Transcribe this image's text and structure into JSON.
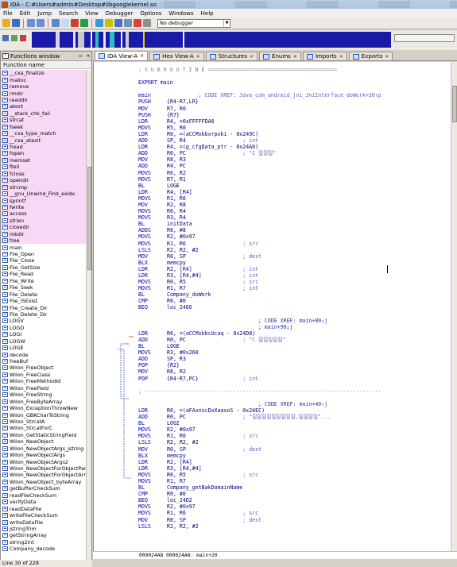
{
  "window": {
    "title": "IDA - C:#Users#admin#Desktop#libgooglekernel.so"
  },
  "menu": [
    "File",
    "Edit",
    "Jump",
    "Search",
    "View",
    "Debugger",
    "Options",
    "Windows",
    "Help"
  ],
  "toolbar": {
    "debugger_select": "No debugger"
  },
  "functions_window": {
    "title": "Functions window",
    "column_header": "Function name",
    "status": "Line 30 of 228",
    "items": [
      {
        "name": "__cxa_finalize",
        "lib": true
      },
      {
        "name": "malloc",
        "lib": true
      },
      {
        "name": "remove",
        "lib": true
      },
      {
        "name": "rmdir",
        "lib": true
      },
      {
        "name": "readdir",
        "lib": true
      },
      {
        "name": "abort",
        "lib": true
      },
      {
        "name": "__stack_chk_fail",
        "lib": true
      },
      {
        "name": "strcat",
        "lib": true
      },
      {
        "name": "fseek",
        "lib": true
      },
      {
        "name": "__cxa_type_match",
        "lib": true
      },
      {
        "name": "__cxa_atexit",
        "lib": true
      },
      {
        "name": "fread",
        "lib": true
      },
      {
        "name": "fopen",
        "lib": true
      },
      {
        "name": "memset",
        "lib": true
      },
      {
        "name": "ftell",
        "lib": true
      },
      {
        "name": "fclose",
        "lib": true
      },
      {
        "name": "opendir",
        "lib": true
      },
      {
        "name": "strcmp",
        "lib": true
      },
      {
        "name": "__gnu_Unwind_Find_exidx",
        "lib": true
      },
      {
        "name": "sprintf",
        "lib": true
      },
      {
        "name": "fwrite",
        "lib": true
      },
      {
        "name": "access",
        "lib": true
      },
      {
        "name": "strlen",
        "lib": true
      },
      {
        "name": "closedir",
        "lib": true
      },
      {
        "name": "mkdir",
        "lib": true
      },
      {
        "name": "free",
        "lib": true
      },
      {
        "name": "main",
        "lib": false
      },
      {
        "name": "File_Open",
        "lib": false
      },
      {
        "name": "File_Close",
        "lib": false
      },
      {
        "name": "File_GetSize",
        "lib": false
      },
      {
        "name": "File_Read",
        "lib": false
      },
      {
        "name": "File_Write",
        "lib": false
      },
      {
        "name": "File_Seek",
        "lib": false
      },
      {
        "name": "File_Delete",
        "lib": false
      },
      {
        "name": "File_ISExist",
        "lib": false
      },
      {
        "name": "File_Create_Dir",
        "lib": false
      },
      {
        "name": "File_Delete_Dir",
        "lib": false
      },
      {
        "name": "LOGV",
        "lib": false
      },
      {
        "name": "LOGD",
        "lib": false
      },
      {
        "name": "LOGI",
        "lib": false
      },
      {
        "name": "LOGW",
        "lib": false
      },
      {
        "name": "LOGE",
        "lib": false
      },
      {
        "name": "decode",
        "lib": false
      },
      {
        "name": "freeBuf",
        "lib": false
      },
      {
        "name": "Wilon_FreeObject",
        "lib": false
      },
      {
        "name": "Wilon_FreeClass",
        "lib": false
      },
      {
        "name": "Wilon_FreeMethodId",
        "lib": false
      },
      {
        "name": "Wilon_FreeField",
        "lib": false
      },
      {
        "name": "Wilon_FreeString",
        "lib": false
      },
      {
        "name": "Wilon_FreeByteArray",
        "lib": false
      },
      {
        "name": "Wilon_ExceptionThrowNew",
        "lib": false
      },
      {
        "name": "Wilon_GBKCharToString",
        "lib": false
      },
      {
        "name": "Wilon_StrcatA",
        "lib": false
      },
      {
        "name": "Wilon_StrcatForC",
        "lib": false
      },
      {
        "name": "Wilon_GetStaticStringField",
        "lib": false
      },
      {
        "name": "Wilon_NewObject",
        "lib": false
      },
      {
        "name": "Wilon_NewObjectArgs_jstring",
        "lib": false
      },
      {
        "name": "Wilon_NewObjectArgs",
        "lib": false
      },
      {
        "name": "Wilon_NewObjectArgs2",
        "lib": false
      },
      {
        "name": "Wilon_NewObjectForObjectParam",
        "lib": false
      },
      {
        "name": "Wilon_NewObjectForObjectArray",
        "lib": false
      },
      {
        "name": "Wilon_NewObject_byteArray",
        "lib": false
      },
      {
        "name": "getBufferCheckSum",
        "lib": false
      },
      {
        "name": "readFileCheckSum",
        "lib": false
      },
      {
        "name": "verifyData",
        "lib": false
      },
      {
        "name": "readDataFile",
        "lib": false
      },
      {
        "name": "writeFileCheckSum",
        "lib": false
      },
      {
        "name": "writeDataFile",
        "lib": false
      },
      {
        "name": "jstringTrim",
        "lib": false
      },
      {
        "name": "getStringArray",
        "lib": false
      },
      {
        "name": "string2int",
        "lib": false
      },
      {
        "name": "Company_decode",
        "lib": false
      }
    ]
  },
  "tabs": [
    {
      "label": "IDA View-A",
      "active": true,
      "closable": true
    },
    {
      "label": "Hex View-A",
      "active": false,
      "closable": true
    },
    {
      "label": "Structures",
      "active": false,
      "closable": true
    },
    {
      "label": "Enums",
      "active": false,
      "closable": true
    },
    {
      "label": "Imports",
      "active": false,
      "closable": true
    },
    {
      "label": "Exports",
      "active": false,
      "closable": true
    }
  ],
  "code": {
    "header": "; S U B R O U T I N E =========================================",
    "lines": [
      {
        "t": "blank"
      },
      {
        "t": "label",
        "text": "EXPORT main"
      },
      {
        "t": "blank"
      },
      {
        "t": "label",
        "text": "main",
        "cm": "; CODE XREF: Java_com_android_jni_JniInterface_doWork+30↑p"
      },
      {
        "t": "ins",
        "m": "PUSH",
        "o": "{R4-R7,LR}"
      },
      {
        "t": "ins",
        "m": "MOV",
        "o": "R7, R0"
      },
      {
        "t": "ins",
        "m": "PUSH",
        "o": "{R7}"
      },
      {
        "t": "ins",
        "m": "LDR",
        "o": "R4, =0xFFFFFDA0"
      },
      {
        "t": "ins",
        "m": "MOVS",
        "o": "R5, R0"
      },
      {
        "t": "ins",
        "m": "LDR",
        "o": "R0, =(aCCMxkbxrpxki - 0x249C)"
      },
      {
        "t": "ins",
        "m": "ADD",
        "o": "SP, R4",
        "cm": "; int"
      },
      {
        "t": "ins",
        "m": "LDR",
        "o": "R4, =(g_cfgData_ptr - 0x24A0)"
      },
      {
        "t": "ins",
        "m": "ADD",
        "o": "R0, PC",
        "cm": "; \"C 릴릴릴\""
      },
      {
        "t": "ins",
        "m": "MOV",
        "o": "R8, R3"
      },
      {
        "t": "ins",
        "m": "ADD",
        "o": "R4, PC"
      },
      {
        "t": "ins",
        "m": "MOVS",
        "o": "R6, R2"
      },
      {
        "t": "ins",
        "m": "MOVS",
        "o": "R7, R1"
      },
      {
        "t": "ins",
        "m": "BL",
        "o": "LOGE"
      },
      {
        "t": "ins",
        "m": "LDR",
        "o": "R4, [R4]"
      },
      {
        "t": "ins",
        "m": "MOVS",
        "o": "R1, R6"
      },
      {
        "t": "ins",
        "m": "MOV",
        "o": "R2, R8"
      },
      {
        "t": "ins",
        "m": "MOVS",
        "o": "R0, R4"
      },
      {
        "t": "ins",
        "m": "MOVS",
        "o": "R3, R4"
      },
      {
        "t": "ins",
        "m": "BL",
        "o": "initData"
      },
      {
        "t": "ins",
        "m": "ADDS",
        "o": "R6, #8"
      },
      {
        "t": "ins",
        "m": "MOVS",
        "o": "R2, #0x97"
      },
      {
        "t": "ins",
        "m": "MOVS",
        "o": "R1, R6",
        "cm": "; src"
      },
      {
        "t": "ins",
        "m": "LSLS",
        "o": "R2, R2, #2"
      },
      {
        "t": "ins",
        "m": "MOV",
        "o": "R0, SP",
        "cm": "; dest"
      },
      {
        "t": "ins",
        "m": "BLX",
        "o": "memcpy"
      },
      {
        "t": "ins",
        "m": "LDR",
        "o": "R2, [R4]",
        "cm": "; int"
      },
      {
        "t": "ins",
        "m": "LDR",
        "o": "R3, [R4,#4]",
        "cm": "; int"
      },
      {
        "t": "ins",
        "m": "MOVS",
        "o": "R0, R5",
        "cm": "; src"
      },
      {
        "t": "ins",
        "m": "MOVS",
        "o": "R1, R7",
        "cm": "; int"
      },
      {
        "t": "ins",
        "m": "BL",
        "o": "Company_doWork"
      },
      {
        "t": "ins",
        "m": "CMP",
        "o": "R0, #0"
      },
      {
        "t": "ins",
        "m": "BEQ",
        "o": "loc_24E6"
      },
      {
        "t": "blank"
      },
      {
        "t": "xref",
        "cm": "; CODE XREF: main+80↓j"
      },
      {
        "t": "xref",
        "cm": "; main+90↓j"
      },
      {
        "t": "ins",
        "m": "LDR",
        "o": "R0, =(aCCMxkbcUcaq - 0x24D8)"
      },
      {
        "t": "ins",
        "m": "ADD",
        "o": "R0, PC",
        "cm": "; \"C 릴릴릴릴릴\""
      },
      {
        "t": "ins",
        "m": "BL",
        "o": "LOGE"
      },
      {
        "t": "ins",
        "m": "MOVS",
        "o": "R3, #0x260"
      },
      {
        "t": "ins",
        "m": "ADD",
        "o": "SP, R3"
      },
      {
        "t": "ins",
        "m": "POP",
        "o": "{R2}"
      },
      {
        "t": "ins",
        "m": "MOV",
        "o": "R8, R2"
      },
      {
        "t": "ins",
        "m": "POP",
        "o": "{R4-R7,PC}",
        "cm": "; int"
      },
      {
        "t": "blank"
      },
      {
        "t": "sep",
        "text": "; ---------------------------------------------------------------------------"
      },
      {
        "t": "blank"
      },
      {
        "t": "xref",
        "cm": "; CODE XREF: main+40↑j"
      },
      {
        "t": "ins",
        "m": "LDR",
        "o": "R0, =(aFAxnscDxXaasoS - 0x24EC)"
      },
      {
        "t": "ins",
        "m": "ADD",
        "o": "R0, PC",
        "cm": "; \"릴릴릴릴릴릴릴릴릴,릴릴릴릴\"..."
      },
      {
        "t": "ins",
        "m": "BL",
        "o": "LOGI"
      },
      {
        "t": "ins",
        "m": "MOVS",
        "o": "R2, #0x97"
      },
      {
        "t": "ins",
        "m": "MOVS",
        "o": "R1, R6",
        "cm": "; src"
      },
      {
        "t": "ins",
        "m": "LSLS",
        "o": "R2, R2, #2"
      },
      {
        "t": "ins",
        "m": "MOV",
        "o": "R0, SP",
        "cm": "; dest"
      },
      {
        "t": "ins",
        "m": "BLX",
        "o": "memcpy"
      },
      {
        "t": "ins",
        "m": "LDR",
        "o": "R2, [R4]"
      },
      {
        "t": "ins",
        "m": "LDR",
        "o": "R3, [R4,#4]"
      },
      {
        "t": "ins",
        "m": "MOVS",
        "o": "R0, R5",
        "cm": "; src"
      },
      {
        "t": "ins",
        "m": "MOVS",
        "o": "R1, R7"
      },
      {
        "t": "ins",
        "m": "BL",
        "o": "Company_getBakDomainName"
      },
      {
        "t": "ins",
        "m": "CMP",
        "o": "R0, #0"
      },
      {
        "t": "ins",
        "m": "BEQ",
        "o": "loc_24D2"
      },
      {
        "t": "ins",
        "m": "MOVS",
        "o": "R2, #0x97"
      },
      {
        "t": "ins",
        "m": "MOVS",
        "o": "R1, R6",
        "cm": "; src"
      },
      {
        "t": "ins",
        "m": "MOV",
        "o": "R0, SP",
        "cm": "; dest"
      },
      {
        "t": "ins",
        "m": "LSLS",
        "o": "R2, R2, #2"
      }
    ],
    "footer": "000024A8 000024A8: main+20"
  },
  "colors": {
    "lib_highlight": "#f7d9f5",
    "code_blue": "#0000b0",
    "nav_band": "#1a1aa8"
  }
}
